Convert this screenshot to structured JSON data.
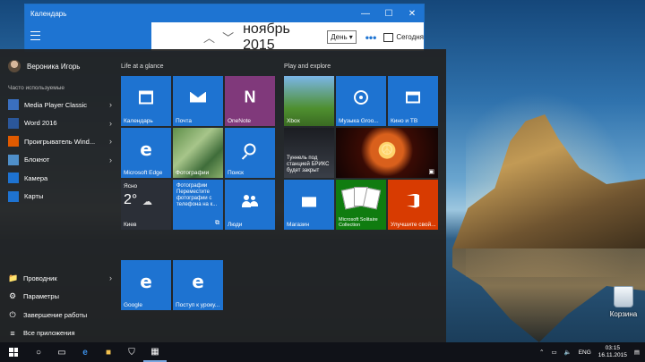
{
  "calendar": {
    "title": "Календарь",
    "month": "ноябрь 2015",
    "view_button": "День",
    "today_button": "Сегодня",
    "more": "•••",
    "window_buttons": {
      "minimize": "—",
      "maximize": "☐",
      "close": "✕"
    }
  },
  "start": {
    "user": "Вероника Игорь",
    "most_used_label": "Часто используемые",
    "apps": [
      {
        "label": "Media Player Classic",
        "icon_color": "#3a6fbf",
        "has_arrow": true
      },
      {
        "label": "Word 2016",
        "icon_color": "#2b579a",
        "has_arrow": true
      },
      {
        "label": "Проигрыватель Wind...",
        "icon_color": "#e05a00",
        "has_arrow": true
      },
      {
        "label": "Блокнот",
        "icon_color": "#4f8fc9",
        "has_arrow": true
      },
      {
        "label": "Камера",
        "icon_color": "#1e73d1",
        "has_arrow": false
      },
      {
        "label": "Карты",
        "icon_color": "#1e73d1",
        "has_arrow": false
      }
    ],
    "bottom": [
      {
        "label": "Проводник",
        "icon": "📁",
        "has_arrow": true
      },
      {
        "label": "Параметры",
        "icon": "⚙",
        "has_arrow": false
      },
      {
        "label": "Завершение работы",
        "icon": "⏻",
        "has_arrow": false
      },
      {
        "label": "Все приложения",
        "icon": "≡",
        "has_arrow": false
      }
    ],
    "group_life": "Life at a glance",
    "group_play": "Play and explore",
    "tiles": {
      "calendar": "Календарь",
      "mail": "Почта",
      "onenote": "OneNote",
      "edge": "Microsoft Edge",
      "photos": "Фотографии",
      "search": "Поиск",
      "weather_condition": "Ясно",
      "weather_temp": "2°",
      "weather_city": "Киев",
      "photo_news_title": "Фотографии",
      "photo_news_text": "Переместите фотографии с телефона на к...",
      "people": "Люди",
      "xbox": "Xbox",
      "groove": "Музыка Groo...",
      "movies": "Кино и ТВ",
      "news_text": "Туннель под станцией БРИКС будет закрыт",
      "store": "Магазин",
      "solitaire": "Microsoft Solitaire Collection",
      "office": "Улучшите свой...",
      "google": "Google",
      "post": "Поступ к уроку..."
    }
  },
  "desktop": {
    "recycle_bin": "Корзина"
  },
  "taskbar": {
    "lang": "ENG",
    "time": "03:15",
    "date": "16.11.2015"
  }
}
